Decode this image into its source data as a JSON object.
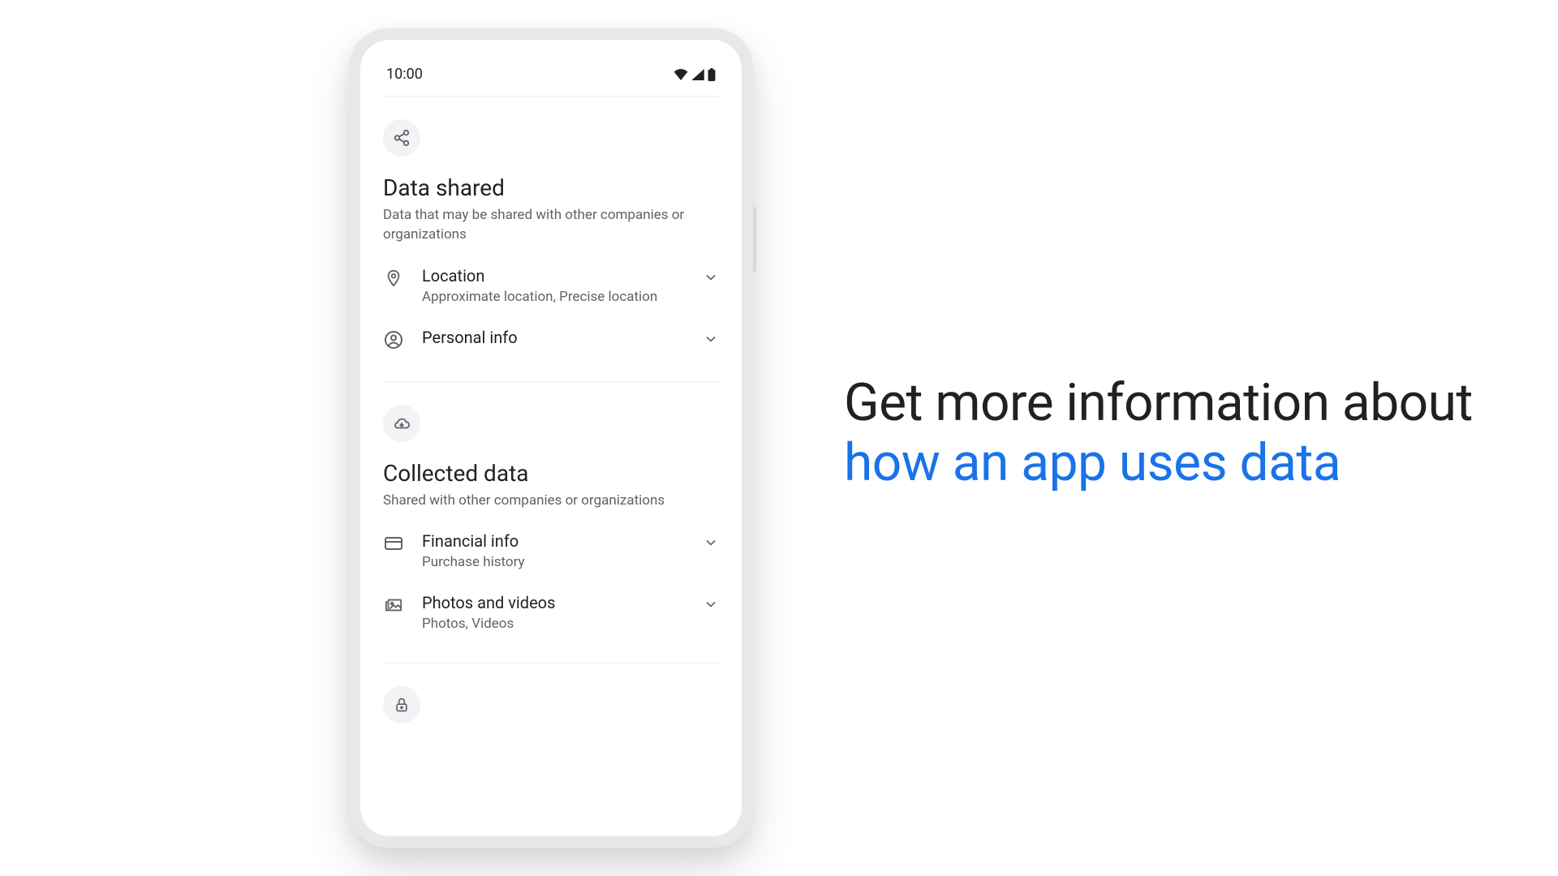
{
  "status": {
    "time": "10:00"
  },
  "sections": {
    "shared": {
      "title": "Data shared",
      "subtitle": "Data that may be shared with other companies or organizations",
      "items": [
        {
          "title": "Location",
          "subtitle": "Approximate location, Precise location"
        },
        {
          "title": "Personal info",
          "subtitle": ""
        }
      ]
    },
    "collected": {
      "title": "Collected data",
      "subtitle": "Shared with other companies or organizations",
      "items": [
        {
          "title": "Financial info",
          "subtitle": "Purchase history"
        },
        {
          "title": "Photos and videos",
          "subtitle": "Photos, Videos"
        }
      ]
    }
  },
  "headline": {
    "line1": "Get more information about",
    "line2": "how an app uses data"
  }
}
